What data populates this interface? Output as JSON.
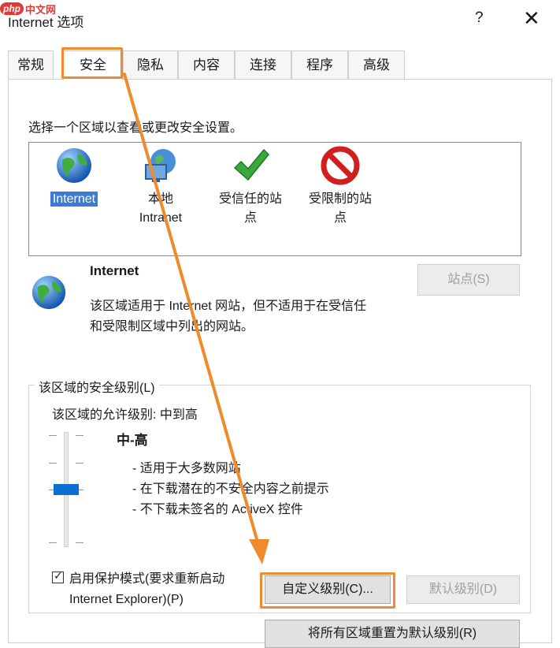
{
  "watermark": {
    "badge": "php",
    "text": "中文网"
  },
  "window": {
    "title": "Internet 选项",
    "help": "?",
    "close": "✕"
  },
  "tabs": [
    "常规",
    "安全",
    "隐私",
    "内容",
    "连接",
    "程序",
    "高级"
  ],
  "active_tab": "安全",
  "security": {
    "instruction": "选择一个区域以查看或更改安全设置。",
    "zones": [
      {
        "label_line1": "Internet",
        "label_line2": "",
        "icon": "globe-icon",
        "selected": true
      },
      {
        "label_line1": "本地",
        "label_line2": "Intranet",
        "icon": "intranet-icon",
        "selected": false
      },
      {
        "label_line1": "受信任的站",
        "label_line2": "点",
        "icon": "checkmark-icon",
        "selected": false
      },
      {
        "label_line1": "受限制的站",
        "label_line2": "点",
        "icon": "restricted-icon",
        "selected": false
      }
    ],
    "selected_zone": {
      "name": "Internet",
      "description_line1": "该区域适用于 Internet 网站，但不适用于在受信任",
      "description_line2": "和受限制区域中列出的网站。"
    },
    "sites_button": "站点(S)",
    "level_group_title": "该区域的安全级别(L)",
    "allowed_levels": "该区域的允许级别: 中到高",
    "level_name": "中-高",
    "level_bullets": [
      "- 适用于大多数网站",
      "- 在下载潜在的不安全内容之前提示",
      "- 不下载未签名的 ActiveX 控件"
    ],
    "slider_level": "中-高",
    "protected_mode": {
      "checked": true,
      "label_line1": "启用保护模式(要求重新启动",
      "label_line2": "Internet Explorer)(P)"
    },
    "custom_level_button": "自定义级别(C)...",
    "default_level_button": "默认级别(D)",
    "reset_all_button": "将所有区域重置为默认级别(R)"
  },
  "colors": {
    "accent": "#0a6fd1",
    "annotation": "#f08a2a",
    "selection": "#3a7bd5"
  }
}
